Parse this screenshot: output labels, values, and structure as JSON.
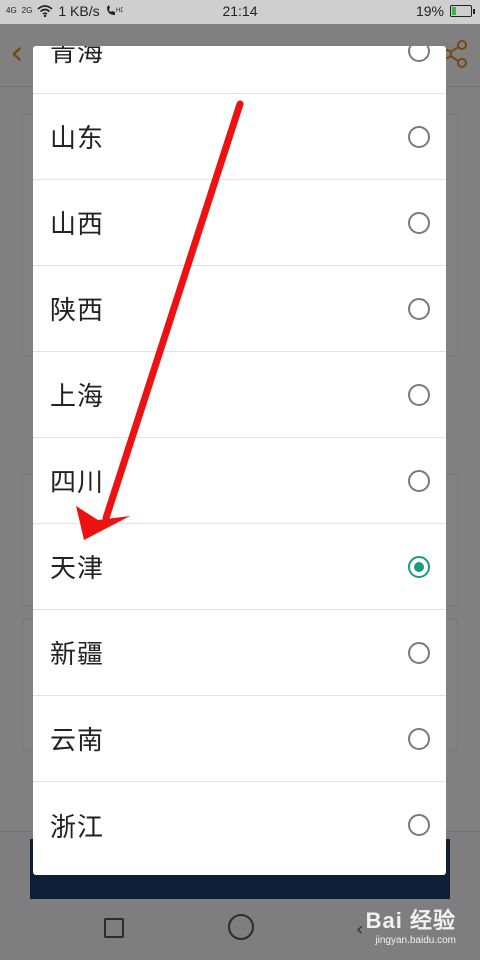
{
  "status_bar": {
    "signal_1": "4G",
    "signal_2": "2G",
    "speed": "1 KB/s",
    "time": "21:14",
    "battery_percent": "19%",
    "battery_level": 0.19
  },
  "dialog": {
    "options": [
      {
        "label": "青海",
        "selected": false
      },
      {
        "label": "山东",
        "selected": false
      },
      {
        "label": "山西",
        "selected": false
      },
      {
        "label": "陕西",
        "selected": false
      },
      {
        "label": "上海",
        "selected": false
      },
      {
        "label": "四川",
        "selected": false
      },
      {
        "label": "天津",
        "selected": true
      },
      {
        "label": "新疆",
        "selected": false
      },
      {
        "label": "云南",
        "selected": false
      },
      {
        "label": "浙江",
        "selected": false
      }
    ]
  },
  "annotation": {
    "arrow_color": "#ee1111"
  },
  "watermark": {
    "brand": "Bai 经验",
    "url": "jingyan.baidu.com"
  }
}
